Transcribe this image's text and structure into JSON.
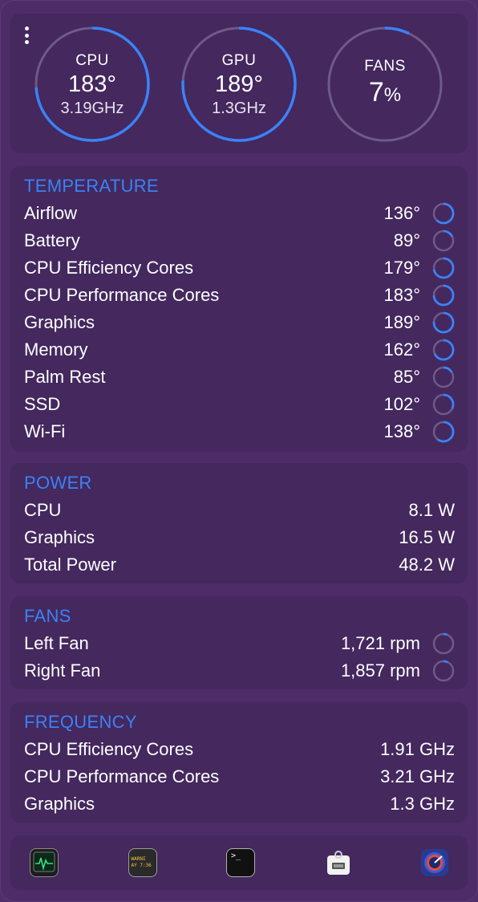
{
  "header": {
    "gauges": [
      {
        "title": "CPU",
        "value": "183°",
        "sub": "3.19GHz",
        "level": 0.74
      },
      {
        "title": "GPU",
        "value": "189°",
        "sub": "1.3GHz",
        "level": 0.76
      },
      {
        "title": "FANS",
        "value": "7",
        "unit": "%",
        "level": 0.07
      }
    ]
  },
  "temperature": {
    "title": "TEMPERATURE",
    "rows": [
      {
        "label": "Airflow",
        "value": "136°",
        "level": 0.62
      },
      {
        "label": "Battery",
        "value": "89°",
        "level": 0.18
      },
      {
        "label": "CPU Efficiency Cores",
        "value": "179°",
        "level": 0.72
      },
      {
        "label": "CPU Performance Cores",
        "value": "183°",
        "level": 0.74
      },
      {
        "label": "Graphics",
        "value": "189°",
        "level": 0.76
      },
      {
        "label": "Memory",
        "value": "162°",
        "level": 0.68
      },
      {
        "label": "Palm Rest",
        "value": "85°",
        "level": 0.16
      },
      {
        "label": "SSD",
        "value": "102°",
        "level": 0.32
      },
      {
        "label": "Wi-Fi",
        "value": "138°",
        "level": 0.6
      }
    ]
  },
  "power": {
    "title": "POWER",
    "rows": [
      {
        "label": "CPU",
        "value": "8.1 W"
      },
      {
        "label": "Graphics",
        "value": "16.5 W"
      },
      {
        "label": "Total Power",
        "value": "48.2 W"
      }
    ]
  },
  "fans": {
    "title": "FANS",
    "rows": [
      {
        "label": "Left Fan",
        "value": "1,721 rpm",
        "level": 0.06
      },
      {
        "label": "Right Fan",
        "value": "1,857 rpm",
        "level": 0.07
      }
    ]
  },
  "frequency": {
    "title": "FREQUENCY",
    "rows": [
      {
        "label": "CPU Efficiency Cores",
        "value": "1.91 GHz"
      },
      {
        "label": "CPU Performance Cores",
        "value": "3.21 GHz"
      },
      {
        "label": "Graphics",
        "value": "1.3 GHz"
      }
    ]
  },
  "dock": {
    "icons": [
      "activity-monitor-icon",
      "console-icon",
      "terminal-icon",
      "system-information-icon",
      "disk-utility-icon"
    ],
    "console_text": [
      "WARNI",
      "AY 7:36"
    ],
    "terminal_text": ">_"
  },
  "colors": {
    "accent": "#3b82f6",
    "ring_track": "#6f5a88",
    "card": "#44285e",
    "background": "#4d2c67"
  }
}
